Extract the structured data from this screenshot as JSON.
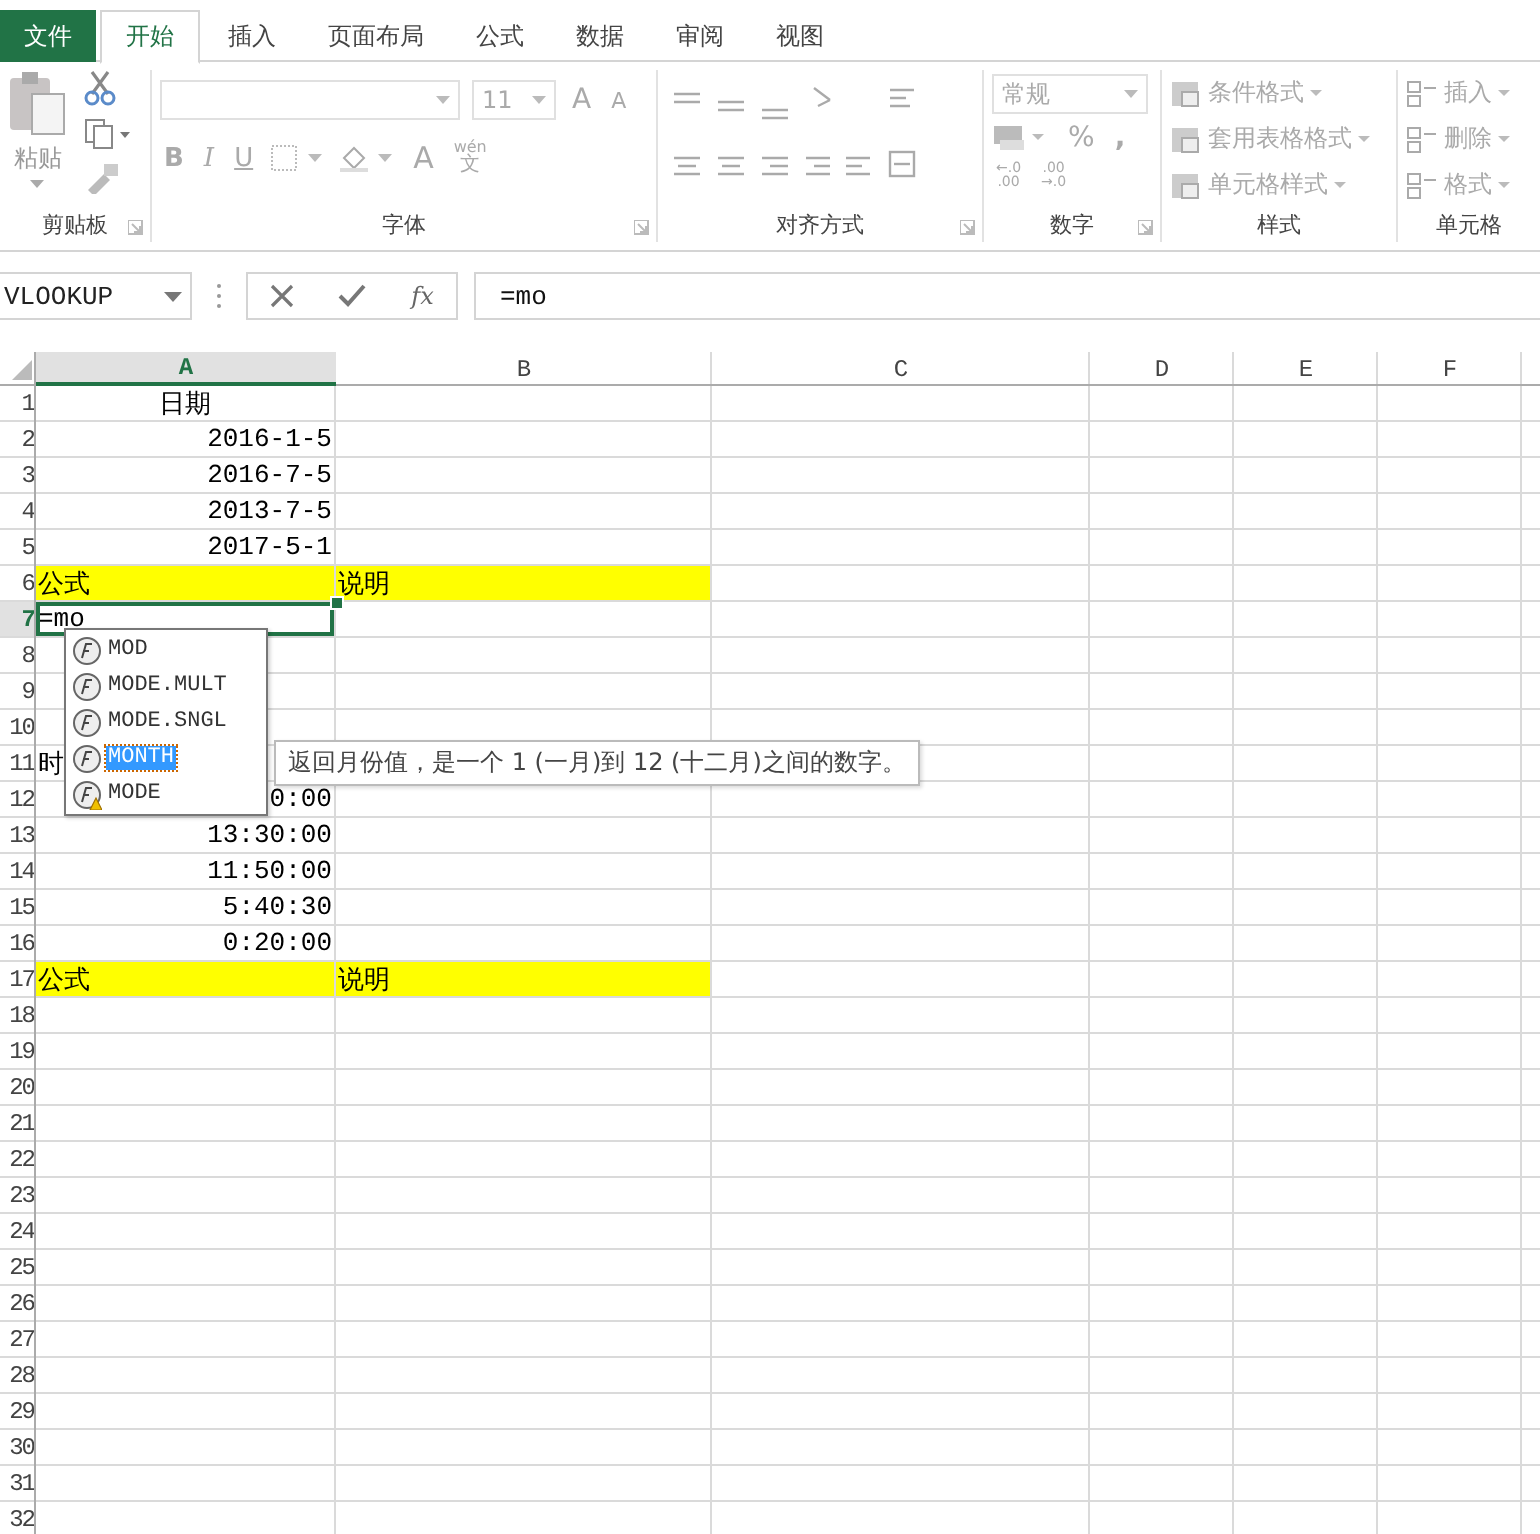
{
  "tabs": [
    {
      "label": "文件",
      "kind": "file",
      "selected": false
    },
    {
      "label": "开始",
      "kind": "tab",
      "selected": true
    },
    {
      "label": "插入",
      "kind": "tab",
      "selected": false
    },
    {
      "label": "页面布局",
      "kind": "tab",
      "selected": false
    },
    {
      "label": "公式",
      "kind": "tab",
      "selected": false
    },
    {
      "label": "数据",
      "kind": "tab",
      "selected": false
    },
    {
      "label": "审阅",
      "kind": "tab",
      "selected": false
    },
    {
      "label": "视图",
      "kind": "tab",
      "selected": false
    }
  ],
  "ribbon": {
    "clipboard": {
      "label": "剪贴板",
      "paste": "粘贴"
    },
    "font": {
      "label": "字体",
      "size": "11",
      "grow": "A",
      "shrink": "A",
      "bold": "B",
      "italic": "I",
      "underline": "U",
      "font_color_letter": "A",
      "phonetic_top": "wén",
      "phonetic_bottom": "文"
    },
    "alignment": {
      "label": "对齐方式"
    },
    "number": {
      "label": "数字",
      "format": "常规",
      "percent": "%",
      "comma": ",",
      "increase_decimal": [
        "←.0",
        ".00"
      ],
      "decrease_decimal": [
        ".00",
        "→.0"
      ]
    },
    "styles": {
      "label": "样式",
      "items": [
        "条件格式",
        "套用表格格式",
        "单元格样式"
      ]
    },
    "cells": {
      "label": "单元格",
      "items": [
        "插入",
        "删除",
        "格式"
      ]
    }
  },
  "formula_bar": {
    "name_box": "VLOOKUP",
    "fx": "fx",
    "formula": "=mo"
  },
  "columns": [
    {
      "label": "A",
      "selected": true
    },
    {
      "label": "B",
      "selected": false
    },
    {
      "label": "C",
      "selected": false
    },
    {
      "label": "D",
      "selected": false
    },
    {
      "label": "E",
      "selected": false
    },
    {
      "label": "F",
      "selected": false
    }
  ],
  "rows": [
    {
      "num": "1",
      "selected": false,
      "highlight": false,
      "a": "日期",
      "kind": "center"
    },
    {
      "num": "2",
      "selected": false,
      "highlight": false,
      "a": "2016-1-5",
      "kind": "number"
    },
    {
      "num": "3",
      "selected": false,
      "highlight": false,
      "a": "2016-7-5",
      "kind": "number"
    },
    {
      "num": "4",
      "selected": false,
      "highlight": false,
      "a": "2013-7-5",
      "kind": "number"
    },
    {
      "num": "5",
      "selected": false,
      "highlight": false,
      "a": "2017-5-1",
      "kind": "number"
    },
    {
      "num": "6",
      "selected": false,
      "highlight": true,
      "a": "公式",
      "kind": "text",
      "b": "说明"
    },
    {
      "num": "7",
      "selected": true,
      "highlight": false,
      "a": "=mo",
      "kind": "text"
    },
    {
      "num": "8",
      "selected": false,
      "highlight": false
    },
    {
      "num": "9",
      "selected": false,
      "highlight": false
    },
    {
      "num": "10",
      "selected": false,
      "highlight": false
    },
    {
      "num": "11",
      "selected": false,
      "highlight": false,
      "a": "时",
      "kind": "text"
    },
    {
      "num": "12",
      "selected": false,
      "highlight": false,
      "a": "0:00",
      "kind": "number"
    },
    {
      "num": "13",
      "selected": false,
      "highlight": false,
      "a": "13:30:00",
      "kind": "number"
    },
    {
      "num": "14",
      "selected": false,
      "highlight": false,
      "a": "11:50:00",
      "kind": "number"
    },
    {
      "num": "15",
      "selected": false,
      "highlight": false,
      "a": "5:40:30",
      "kind": "number"
    },
    {
      "num": "16",
      "selected": false,
      "highlight": false,
      "a": "0:20:00",
      "kind": "number"
    },
    {
      "num": "17",
      "selected": false,
      "highlight": true,
      "a": "公式",
      "kind": "text",
      "b": "说明"
    },
    {
      "num": "18",
      "selected": false,
      "highlight": false
    },
    {
      "num": "19",
      "selected": false,
      "highlight": false
    },
    {
      "num": "20",
      "selected": false,
      "highlight": false
    },
    {
      "num": "21",
      "selected": false,
      "highlight": false
    },
    {
      "num": "22",
      "selected": false,
      "highlight": false
    },
    {
      "num": "23",
      "selected": false,
      "highlight": false
    },
    {
      "num": "24",
      "selected": false,
      "highlight": false
    },
    {
      "num": "25",
      "selected": false,
      "highlight": false
    },
    {
      "num": "26",
      "selected": false,
      "highlight": false
    },
    {
      "num": "27",
      "selected": false,
      "highlight": false
    },
    {
      "num": "28",
      "selected": false,
      "highlight": false
    },
    {
      "num": "29",
      "selected": false,
      "highlight": false
    },
    {
      "num": "30",
      "selected": false,
      "highlight": false
    },
    {
      "num": "31",
      "selected": false,
      "highlight": false
    },
    {
      "num": "32",
      "selected": false,
      "highlight": false
    }
  ],
  "autocomplete": {
    "items": [
      {
        "label": "MOD",
        "kind": "function",
        "selected": false
      },
      {
        "label": "MODE.MULT",
        "kind": "function",
        "selected": false
      },
      {
        "label": "MODE.SNGL",
        "kind": "function",
        "selected": false
      },
      {
        "label": "MONTH",
        "kind": "function",
        "selected": true
      },
      {
        "label": "MODE",
        "kind": "legacy",
        "selected": false
      }
    ],
    "tooltip": "返回月份值，是一个 1 (一月)到 12 (十二月)之间的数字。"
  }
}
